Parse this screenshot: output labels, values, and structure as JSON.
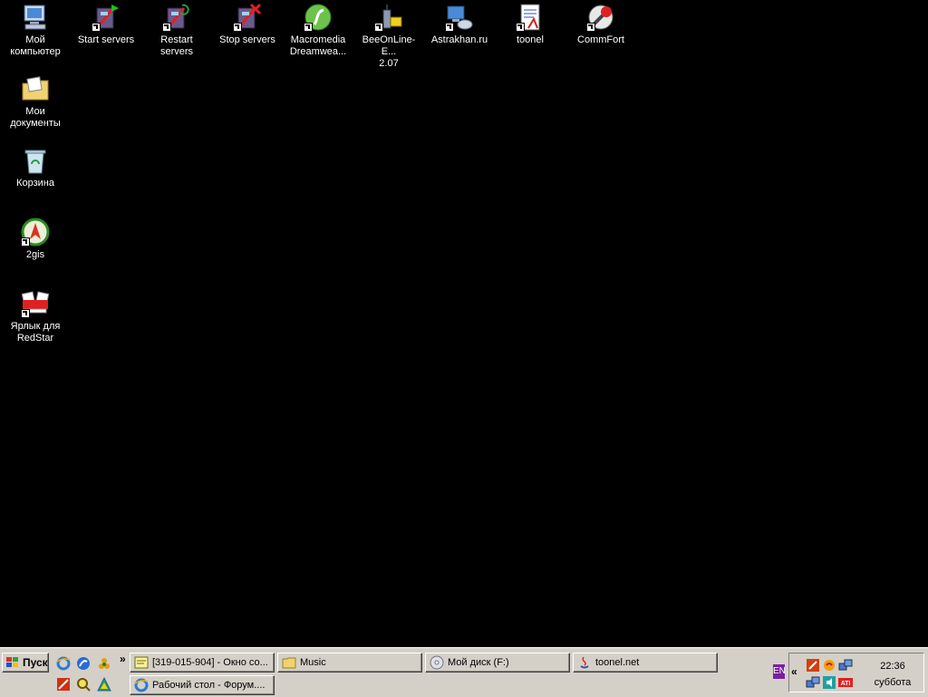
{
  "desktop": {
    "icons": [
      {
        "label": "Мой\nкомпьютер"
      },
      {
        "label": "Start servers"
      },
      {
        "label": "Restart\nservers"
      },
      {
        "label": "Stop servers"
      },
      {
        "label": "Macromedia\nDreamwea..."
      },
      {
        "label": "BeeOnLine-E...\n2.07"
      },
      {
        "label": "Astrakhan.ru"
      },
      {
        "label": "toonel"
      },
      {
        "label": "CommFort"
      },
      {
        "label": "Мои\nдокументы"
      },
      {
        "label": "Корзина"
      },
      {
        "label": "2gis"
      },
      {
        "label": "Ярлык для\nRedStar"
      }
    ]
  },
  "taskbar": {
    "start_label": "Пуск",
    "quick_launch_more": "»",
    "tasks": [
      {
        "label": "[319-015-904] - Окно со..."
      },
      {
        "label": "Music"
      },
      {
        "label": "Мой диск (F:)"
      },
      {
        "label": "toonel.net"
      },
      {
        "label": "Рабочий стол - Форум...."
      }
    ],
    "tray": {
      "language": "EN",
      "expand": "«",
      "time": "22:36",
      "day": "суббота"
    }
  },
  "colors": {
    "desktop_bg": "#000000",
    "taskbar_bg": "#d4d0c8",
    "language_badge": "#7a1fa2"
  }
}
